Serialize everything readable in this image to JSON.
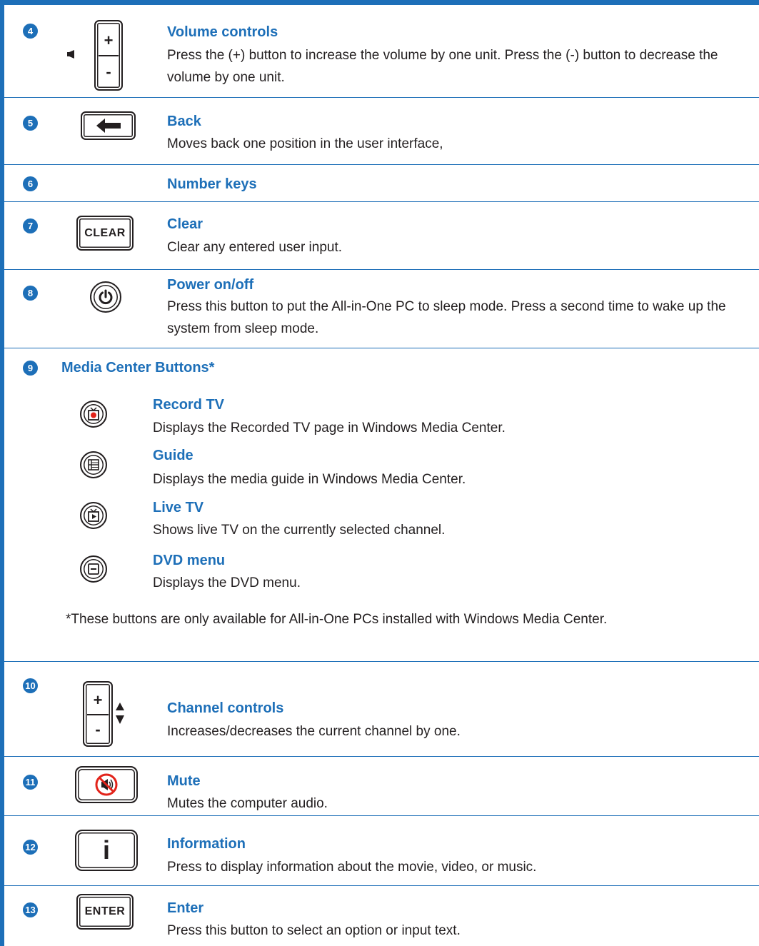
{
  "rows": {
    "volume": {
      "num": "4",
      "title": "Volume controls",
      "desc": "Press the (+) button to increase the volume by one unit. Press the (-) button to decrease the volume by one unit.",
      "plus": "+",
      "minus": "-"
    },
    "back": {
      "num": "5",
      "title": "Back",
      "desc": "Moves back one position in the user interface,"
    },
    "number": {
      "num": "6",
      "title": "Number keys"
    },
    "clear": {
      "num": "7",
      "title": "Clear",
      "desc": "Clear any entered user input.",
      "button_label": "CLEAR"
    },
    "power": {
      "num": "8",
      "title": "Power on/off",
      "desc": "Press this button to put the All-in-One PC to sleep mode. Press a second time to wake up the system from sleep mode."
    },
    "media": {
      "num": "9",
      "title": "Media Center Buttons*",
      "items": [
        {
          "title": "Record TV",
          "desc": "Displays the Recorded TV page in Windows Media Center.",
          "icon": "record-tv-icon"
        },
        {
          "title": "Guide",
          "desc": "Displays the media guide in Windows Media Center.",
          "icon": "guide-icon"
        },
        {
          "title": "Live TV",
          "desc": "Shows live TV on the currently selected channel.",
          "icon": "live-tv-icon"
        },
        {
          "title": "DVD menu",
          "desc": "Displays the DVD menu.",
          "icon": "dvd-menu-icon"
        }
      ],
      "footnote": "*These buttons are only available for All-in-One PCs installed with Windows Media Center."
    },
    "channel": {
      "num": "10",
      "title": "Channel controls",
      "desc": "Increases/decreases the current channel by one.",
      "plus": "+",
      "minus": "-"
    },
    "mute": {
      "num": "11",
      "title": "Mute",
      "desc": "Mutes the computer audio."
    },
    "info": {
      "num": "12",
      "title": "Information",
      "desc": "Press to display information about the movie, video, or music.",
      "button_label": "i"
    },
    "enter": {
      "num": "13",
      "title": "Enter",
      "desc": "Press this button to select an option or input text.",
      "button_label": "ENTER"
    }
  },
  "colors": {
    "accent": "#1d6fb8",
    "text": "#231f20",
    "record_red": "#e2231a",
    "mute_red": "#e2231a"
  }
}
